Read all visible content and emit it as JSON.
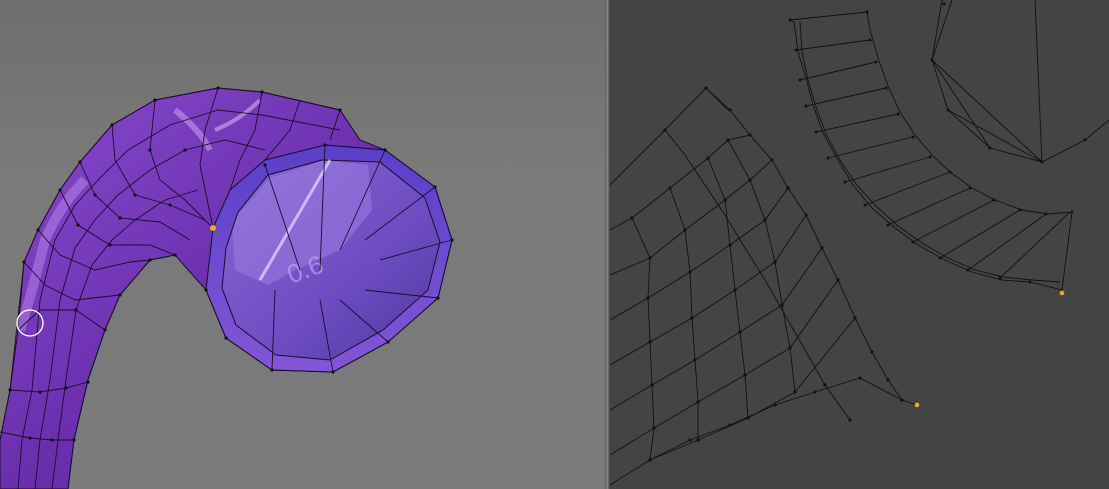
{
  "viewport": {
    "object": "curved-tube-mesh",
    "mesh_color": "#7d3fb6",
    "mesh_highlight": "#b06ee6",
    "selected_vertex_color": "#f5a623",
    "brush_cursor": "brush-circle-cursor"
  },
  "uv_editor": {
    "background": "#444444",
    "edge_color": "#111111",
    "selected_vertex_color": "#f5a623",
    "islands": [
      "uv-island-large-arc",
      "uv-island-ring-strip",
      "uv-island-cap-polygon"
    ]
  }
}
